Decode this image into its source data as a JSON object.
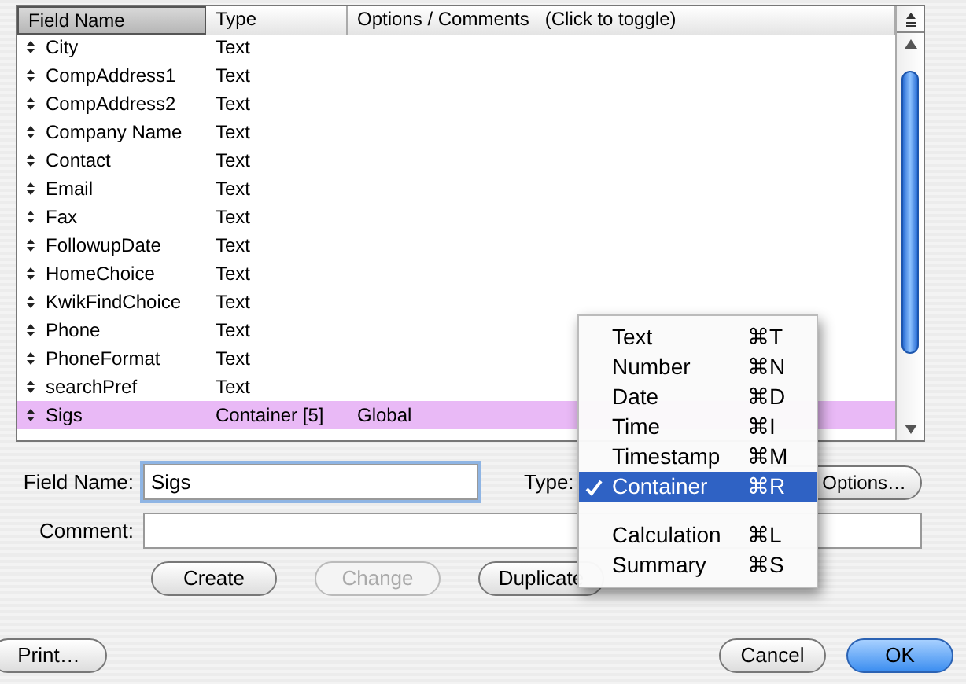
{
  "table": {
    "columns": [
      {
        "label": "Field Name",
        "selected": true
      },
      {
        "label": "Type",
        "selected": false
      },
      {
        "label": "Options / Comments   (Click to toggle)",
        "selected": false
      }
    ],
    "rows": [
      {
        "name": "City",
        "type": "Text",
        "selected": false
      },
      {
        "name": "CompAddress1",
        "type": "Text",
        "selected": false
      },
      {
        "name": "CompAddress2",
        "type": "Text",
        "selected": false
      },
      {
        "name": "Company Name",
        "type": "Text",
        "selected": false
      },
      {
        "name": "Contact",
        "type": "Text",
        "selected": false
      },
      {
        "name": "Email",
        "type": "Text",
        "selected": false
      },
      {
        "name": "Fax",
        "type": "Text",
        "selected": false
      },
      {
        "name": "FollowupDate",
        "type": "Text",
        "selected": false
      },
      {
        "name": "HomeChoice",
        "type": "Text",
        "selected": false
      },
      {
        "name": "KwikFindChoice",
        "type": "Text",
        "selected": false
      },
      {
        "name": "Phone",
        "type": "Text",
        "selected": false
      },
      {
        "name": "PhoneFormat",
        "type": "Text",
        "selected": false
      },
      {
        "name": "searchPref",
        "type": "Text",
        "selected": false
      },
      {
        "name": "Sigs",
        "type": "Container [5]",
        "options": "Global",
        "selected": true
      }
    ]
  },
  "field_name": {
    "label": "Field Name:",
    "value": "Sigs"
  },
  "type_label": "Type:",
  "options_button": "Options…",
  "comment": {
    "label": "Comment:"
  },
  "buttons": [
    {
      "label": "Create",
      "disabled": false
    },
    {
      "label": "Change",
      "disabled": true
    },
    {
      "label": "Duplicate",
      "disabled": false
    }
  ],
  "type_menu": [
    {
      "kind": "item",
      "label": "Text",
      "shortcut": "⌘T",
      "checked": false,
      "selected": false
    },
    {
      "kind": "item",
      "label": "Number",
      "shortcut": "⌘N",
      "checked": false,
      "selected": false
    },
    {
      "kind": "item",
      "label": "Date",
      "shortcut": "⌘D",
      "checked": false,
      "selected": false
    },
    {
      "kind": "item",
      "label": "Time",
      "shortcut": "⌘I",
      "checked": false,
      "selected": false
    },
    {
      "kind": "item",
      "label": "Timestamp",
      "shortcut": "⌘M",
      "checked": false,
      "selected": false
    },
    {
      "kind": "item",
      "label": "Container",
      "shortcut": "⌘R",
      "checked": true,
      "selected": true
    },
    {
      "kind": "separator"
    },
    {
      "kind": "item",
      "label": "Calculation",
      "shortcut": "⌘L",
      "checked": false,
      "selected": false
    },
    {
      "kind": "item",
      "label": "Summary",
      "shortcut": "⌘S",
      "checked": false,
      "selected": false
    }
  ],
  "footer_buttons": [
    {
      "label": "Print…",
      "default": false
    },
    {
      "label": "Cancel",
      "default": false
    },
    {
      "label": "OK",
      "default": true
    }
  ]
}
